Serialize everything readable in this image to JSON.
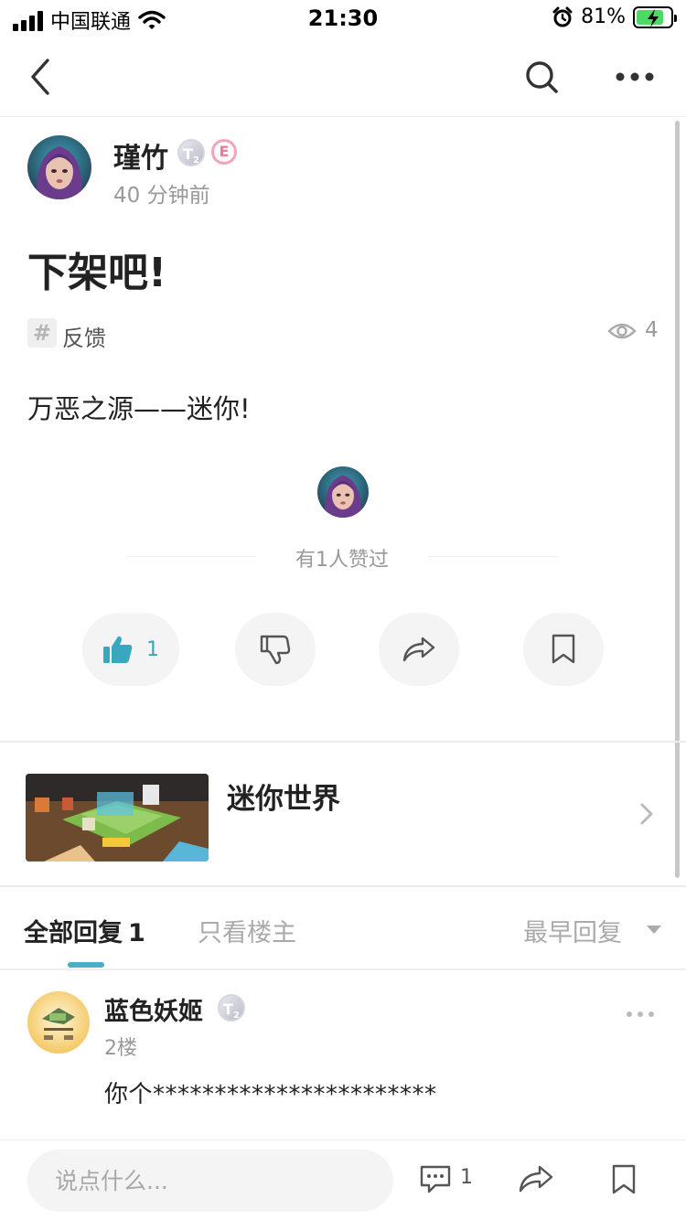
{
  "status_bar": {
    "carrier": "中国联通",
    "time": "21:30",
    "battery": "81%",
    "battery_level": 0.81,
    "icons": [
      "signal-icon",
      "wifi-icon",
      "alarm-icon",
      "battery-charging-icon"
    ]
  },
  "nav": {
    "icons": [
      "back-icon",
      "search-icon",
      "more-icon"
    ]
  },
  "post": {
    "author": {
      "name": "瑾竹",
      "level": "T",
      "level_sub": "2",
      "badge": "E"
    },
    "time": "40 分钟前",
    "title": "下架吧!",
    "tag": "反馈",
    "views": "4",
    "body": "万恶之源——迷你!",
    "likes_text": "有1人赞过",
    "actions": {
      "like_count": "1"
    }
  },
  "game": {
    "name": "迷你世界"
  },
  "replies": {
    "tab_all": "全部回复",
    "tab_all_count": "1",
    "tab_owner": "只看楼主",
    "sort": "最早回复",
    "items": [
      {
        "name": "蓝色妖姬",
        "level": "T",
        "level_sub": "2",
        "floor": "2楼",
        "text": "你个***********************"
      }
    ]
  },
  "bottom_bar": {
    "placeholder": "说点什么...",
    "comment_count": "1"
  },
  "colors": {
    "accent": "#4aaec4",
    "like": "#39a7be",
    "muted": "#999999"
  }
}
